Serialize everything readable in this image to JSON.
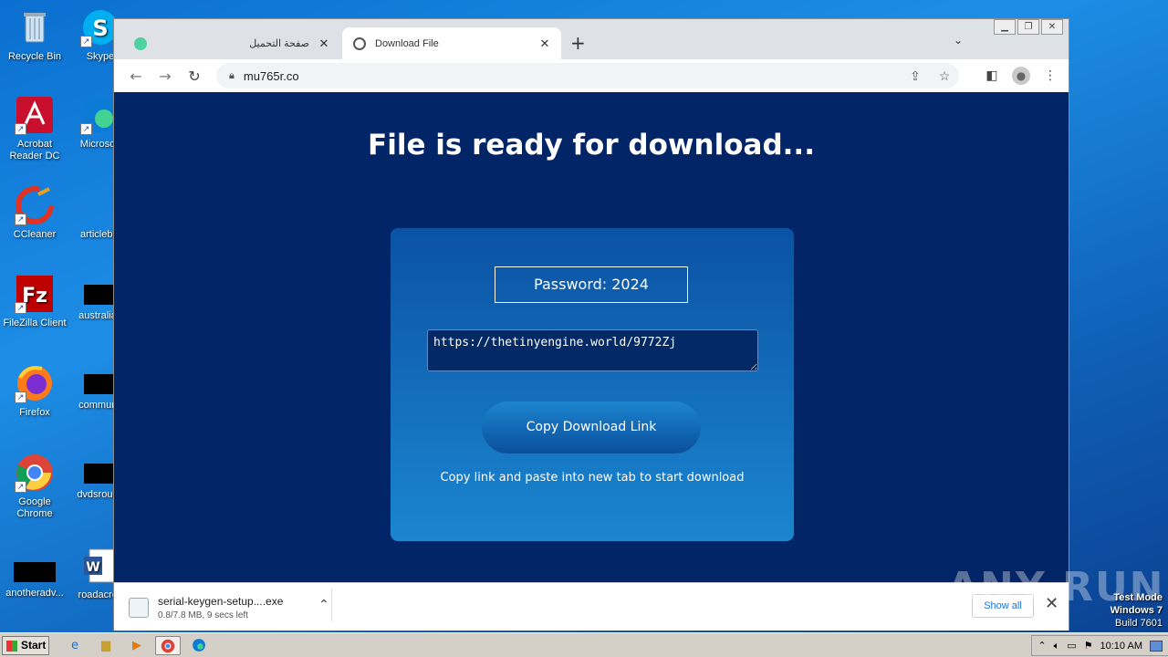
{
  "desktop": {
    "icons_left": [
      {
        "label": "Recycle Bin"
      },
      {
        "label": "Acrobat Reader DC"
      },
      {
        "label": "CCleaner"
      },
      {
        "label": "FileZilla Client"
      },
      {
        "label": "Firefox"
      },
      {
        "label": "Google Chrome"
      },
      {
        "label": "anotheradv..."
      }
    ],
    "icons_right": [
      {
        "label": "Skype"
      },
      {
        "label": "Microsoft"
      },
      {
        "label": "articlebig"
      },
      {
        "label": "australian"
      },
      {
        "label": "communit"
      },
      {
        "label": "dvdsround"
      },
      {
        "label": "roadacros"
      }
    ]
  },
  "browser": {
    "tabs": [
      {
        "title": "صفحة التحميل",
        "active": false
      },
      {
        "title": "Download File",
        "active": true
      }
    ],
    "url": "mu765r.co"
  },
  "page": {
    "title": "File is ready for download...",
    "password": "Password: 2024",
    "link_value": "https://thetinyengine.world/9772Zj",
    "copy_button": "Copy Download Link",
    "hint": "Copy link and paste into new tab to start download"
  },
  "download_shelf": {
    "filename": "serial-keygen-setup....exe",
    "status": "0.8/7.8 MB, 9 secs left",
    "show_all": "Show all"
  },
  "watermark": "ANY RUN",
  "test_mode": {
    "line1": "Test Mode",
    "line2": "Windows 7",
    "line3": "Build 7601"
  },
  "taskbar": {
    "start": "Start",
    "clock": "10:10 AM"
  }
}
